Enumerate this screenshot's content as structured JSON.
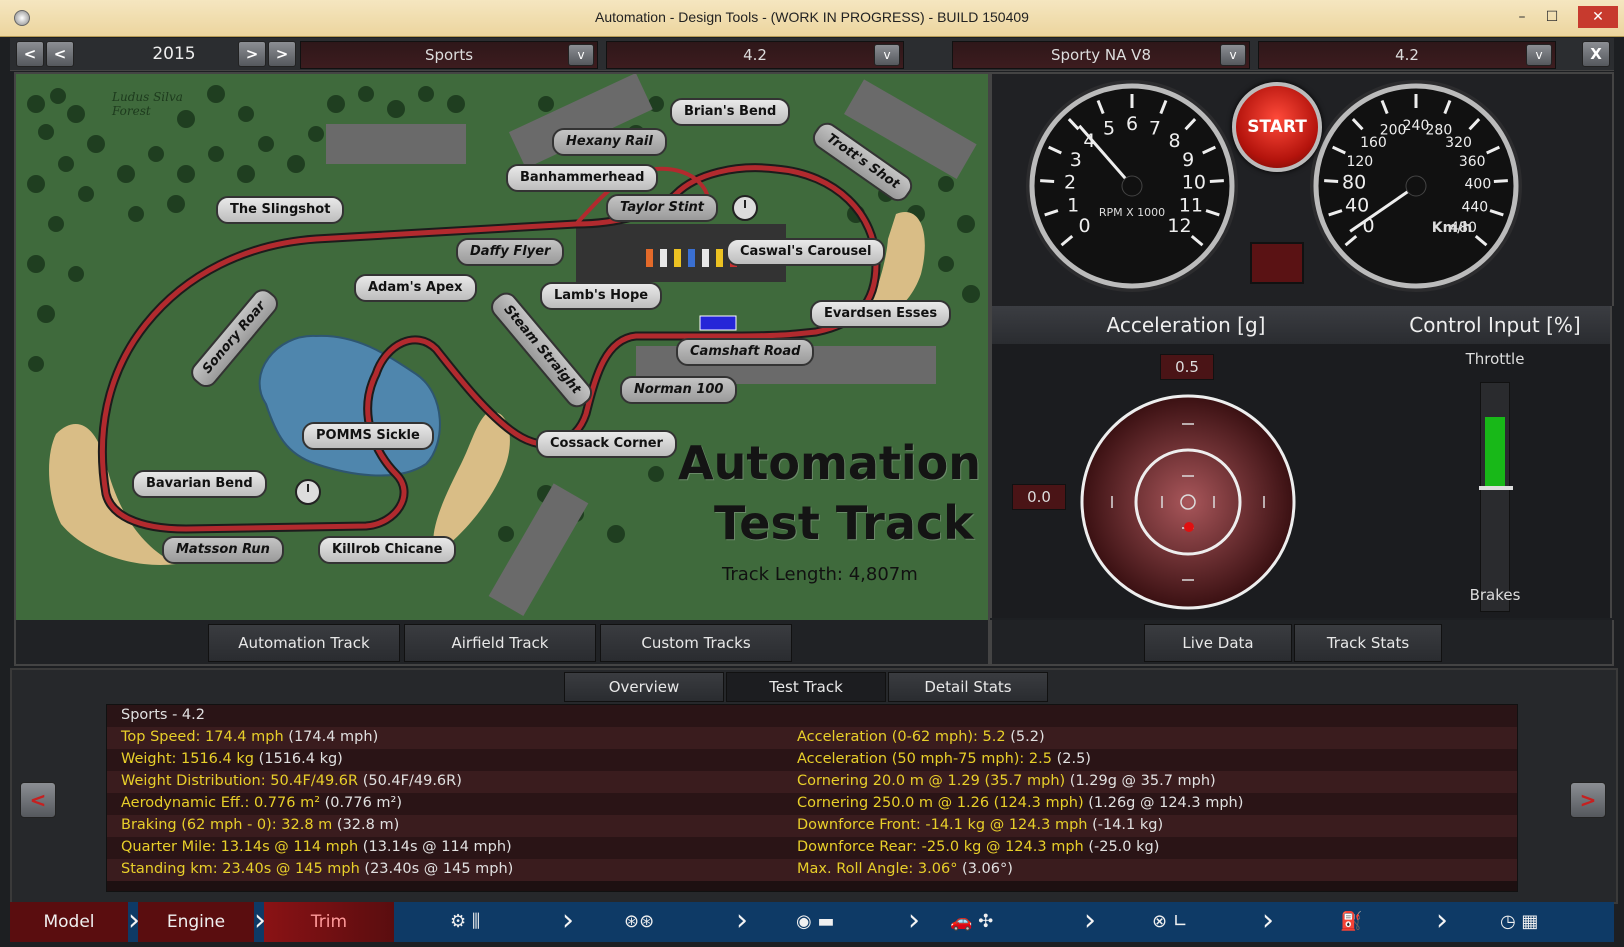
{
  "window": {
    "title": "Automation - Design Tools - (WORK IN PROGRESS) - BUILD 150409"
  },
  "topbar": {
    "year": "2015",
    "model_select": "Sports",
    "model_trim_select": "4.2",
    "engine_select": "Sporty NA V8",
    "engine_trim_select": "4.2",
    "dropdown_glyph": "v",
    "close_glyph": "X"
  },
  "map": {
    "forest_label": "Ludus Silva Forest",
    "title_line1": "Automation",
    "title_line2": "Test Track",
    "track_length": "Track Length: 4,807m",
    "corners": [
      "Brian's Bend",
      "Hexany Rail",
      "Trott's Shot",
      "Banhammerhead",
      "Taylor Stint",
      "The Slingshot",
      "Daffy Flyer",
      "Caswal's Carousel",
      "Adam's Apex",
      "Lamb's Hope",
      "Evardsen Esses",
      "Sonory Roar",
      "Steam Straight",
      "Camshaft Road",
      "Norman 100",
      "POMMS Sickle",
      "Cossack Corner",
      "Bavarian Bend",
      "Matsson Run",
      "Killrob Chicane"
    ]
  },
  "map_tabs": [
    "Automation Track",
    "Airfield Track",
    "Custom Tracks"
  ],
  "gauges": {
    "start_label": "START",
    "rpm_label": "RPM X 1000",
    "rpm_ticks": [
      "0",
      "1",
      "2",
      "3",
      "4",
      "5",
      "6",
      "7",
      "8",
      "9",
      "10",
      "11",
      "12"
    ],
    "rpm_value": 4.1,
    "speed_label": "Km/h",
    "speed_ticks": [
      "0",
      "40",
      "80",
      "120",
      "160",
      "200",
      "240",
      "280",
      "320",
      "360",
      "400",
      "440",
      "480"
    ],
    "speed_value": 10
  },
  "accel": {
    "title": "Acceleration [g]",
    "longitudinal": "0.5",
    "lateral": "0.0"
  },
  "control": {
    "title": "Control Input [%]",
    "throttle_label": "Throttle",
    "brakes_label": "Brakes",
    "throttle_value": 0.45
  },
  "right_tabs": [
    "Live Data",
    "Track Stats"
  ],
  "stats_tabs": [
    "Overview",
    "Test Track",
    "Detail Stats"
  ],
  "stats": {
    "heading": "Sports - 4.2",
    "left": [
      {
        "k": "Top Speed: 174.4 mph",
        "v": " (174.4 mph)"
      },
      {
        "k": "Weight: 1516.4 kg",
        "v": " (1516.4 kg)"
      },
      {
        "k": "Weight Distribution: 50.4F/49.6R",
        "v": " (50.4F/49.6R)"
      },
      {
        "k": "Aerodynamic Eff.: 0.776 m²",
        "v": " (0.776 m²)"
      },
      {
        "k": "Braking (62 mph - 0): 32.8 m",
        "v": " (32.8 m)"
      },
      {
        "k": "Quarter Mile: 13.14s @ 114 mph",
        "v": " (13.14s @ 114 mph)"
      },
      {
        "k": "Standing km: 23.40s @ 145 mph",
        "v": " (23.40s @ 145 mph)"
      }
    ],
    "right": [
      {
        "k": "Acceleration (0-62 mph): 5.2",
        "v": " (5.2)"
      },
      {
        "k": "Acceleration (50 mph-75 mph): 2.5",
        "v": " (2.5)"
      },
      {
        "k": "Cornering 20.0 m @ 1.29 (35.7 mph)",
        "v": " (1.29g @ 35.7 mph)"
      },
      {
        "k": "Cornering 250.0 m @ 1.26 (124.3 mph)",
        "v": " (1.26g @ 124.3 mph)"
      },
      {
        "k": "Downforce Front: -14.1 kg @ 124.3 mph",
        "v": " (-14.1 kg)"
      },
      {
        "k": "Downforce Rear: -25.0 kg @ 124.3 mph",
        "v": " (-25.0 kg)"
      },
      {
        "k": "Max. Roll Angle: 3.06°",
        "v": " (3.06°)"
      }
    ]
  },
  "bottom_nav": {
    "model": "Model",
    "engine": "Engine",
    "trim": "Trim"
  }
}
